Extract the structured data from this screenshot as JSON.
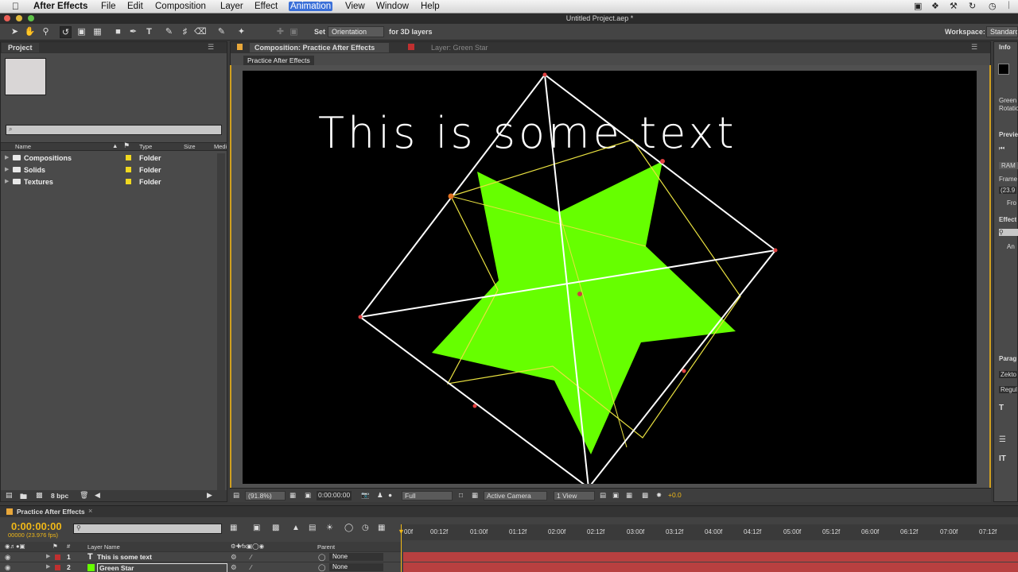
{
  "menubar": {
    "app_name": "After Effects",
    "items": [
      "File",
      "Edit",
      "Composition",
      "Layer",
      "Effect",
      "Animation",
      "View",
      "Window",
      "Help"
    ],
    "active_item": "Animation"
  },
  "window": {
    "title": "Untitled Project.aep *"
  },
  "toolbar": {
    "set_label": "Set",
    "orientation_value": "Orientation",
    "for_3d_label": "for 3D layers",
    "workspace_label": "Workspace:",
    "workspace_value": "Standard"
  },
  "project_panel": {
    "tab_label": "Project",
    "search_placeholder": "⌕",
    "columns": {
      "name": "Name",
      "type": "Type",
      "size": "Size",
      "media": "Medi"
    },
    "items": [
      {
        "name": "Compositions",
        "type": "Folder"
      },
      {
        "name": "Solids",
        "type": "Folder"
      },
      {
        "name": "Textures",
        "type": "Folder"
      }
    ],
    "bpc_label": "8 bpc",
    "label_color": "#f0d820"
  },
  "composition_panel": {
    "tab_label": "Composition: Practice After Effects",
    "layer_tab_label": "Layer: Green Star",
    "subtab_label": "Practice After Effects",
    "canvas_text": "This is some text",
    "footer": {
      "zoom": "(91.8%)",
      "timecode": "0:00:00:00",
      "resolution": "Full",
      "camera": "Active Camera",
      "views": "1 View",
      "exposure": "+0.0"
    },
    "star_color": "#66ff00"
  },
  "right_panels": {
    "info_label": "Info",
    "info_lines": [
      "Green",
      "Rotatio"
    ],
    "preview_label": "Previe",
    "ram_label": "RAM",
    "frame_label": "Frame",
    "frame_value": "(23.9",
    "from_label": "Fro",
    "effects_label": "Effect",
    "effects_item": "An",
    "paragraph_label": "Parag",
    "font_name": "Zekto",
    "font_style": "Regul"
  },
  "timeline": {
    "tab_label": "Practice After Effects",
    "timecode": "0:00:00:00",
    "fps": "00000 (23.976 fps)",
    "ruler_labels": [
      "00f",
      "00:12f",
      "01:00f",
      "01:12f",
      "02:00f",
      "02:12f",
      "03:00f",
      "03:12f",
      "04:00f",
      "04:12f",
      "05:00f",
      "05:12f",
      "06:00f",
      "06:12f",
      "07:00f",
      "07:12f"
    ],
    "columns": {
      "layer_name": "Layer Name",
      "parent": "Parent"
    },
    "layers": [
      {
        "number": "1",
        "name": "This is some text",
        "parent": "None",
        "label_color": "#c03030"
      },
      {
        "number": "2",
        "name": "Green Star",
        "parent": "None",
        "label_color": "#c03030"
      }
    ]
  }
}
